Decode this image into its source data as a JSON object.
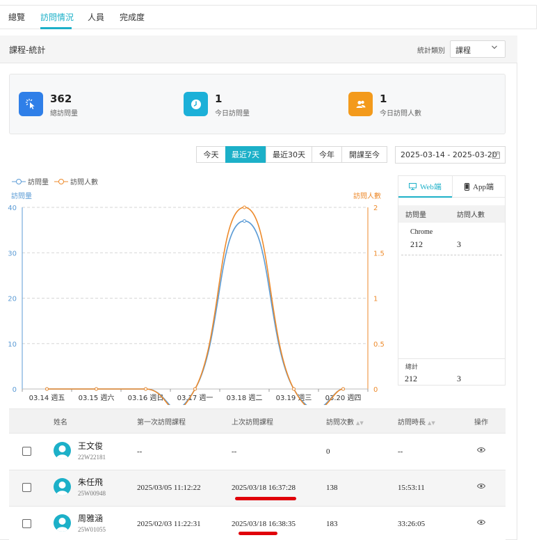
{
  "tabs": [
    {
      "label": "總覽"
    },
    {
      "label": "訪問情況"
    },
    {
      "label": "人員"
    },
    {
      "label": "完成度"
    }
  ],
  "panel": {
    "title": "課程-統計",
    "category_label": "統計類別",
    "category_value": "課程"
  },
  "stats": [
    {
      "value": "362",
      "label": "總訪問量",
      "color": "#2f7fe8",
      "icon": "cursor-click-icon"
    },
    {
      "value": "1",
      "label": "今日訪問量",
      "color": "#1cb0d8",
      "icon": "clock-icon"
    },
    {
      "value": "1",
      "label": "今日訪問人數",
      "color": "#f39a1c",
      "icon": "users-icon"
    }
  ],
  "range_buttons": [
    "今天",
    "最近7天",
    "最近30天",
    "今年",
    "開課至今"
  ],
  "range_active": 1,
  "date_range": "2025-03-14 - 2025-03-20",
  "legend": {
    "visits": "訪問量",
    "visitors": "訪問人數"
  },
  "chart_data": {
    "type": "line",
    "x": [
      "03.14 週五",
      "03.15 週六",
      "03.16 週日",
      "03.17 週一",
      "03.18 週二",
      "03.19 週三",
      "03.20 週四"
    ],
    "series": [
      {
        "name": "訪問量",
        "axis": "left",
        "color": "#5b9bd5",
        "values": [
          0,
          0,
          0,
          0,
          37,
          0,
          0
        ]
      },
      {
        "name": "訪問人數",
        "axis": "right",
        "color": "#ed8a2b",
        "values": [
          0,
          0,
          0,
          0,
          2,
          0,
          0
        ]
      }
    ],
    "ylabel_left": "訪問量",
    "ylabel_right": "訪問人數",
    "ylim_left": [
      0,
      40
    ],
    "yticks_left": [
      "0",
      "10",
      "20",
      "30",
      "40"
    ],
    "ylim_right": [
      0,
      2
    ],
    "yticks_right": [
      "0",
      "0.5",
      "1",
      "1.5",
      "2"
    ],
    "grid": true,
    "smooth": true
  },
  "side": {
    "tab_web": "Web端",
    "tab_app": "App端",
    "col_visits": "訪問量",
    "col_visitors": "訪問人數",
    "browser": "Chrome",
    "browser_visits": "212",
    "browser_visitors": "3",
    "total_label": "總計",
    "total_visits": "212",
    "total_visitors": "3"
  },
  "table": {
    "headers": [
      "姓名",
      "第一次訪問課程",
      "上次訪問課程",
      "訪問次數",
      "訪問時長",
      "操作"
    ],
    "rows": [
      {
        "name": "王文俊",
        "id": "22W22181",
        "first": "--",
        "last": "--",
        "count": "0",
        "duration": "--",
        "highlight": false
      },
      {
        "name": "朱任飛",
        "id": "25W00948",
        "first": "2025/03/05 11:12:22",
        "last": "2025/03/18 16:37:28",
        "count": "138",
        "duration": "15:53:11",
        "highlight": true
      },
      {
        "name": "周雅涵",
        "id": "25W01055",
        "first": "2025/02/03 11:22:31",
        "last": "2025/03/18 16:38:35",
        "count": "183",
        "duration": "33:26:05",
        "highlight": false
      }
    ]
  }
}
